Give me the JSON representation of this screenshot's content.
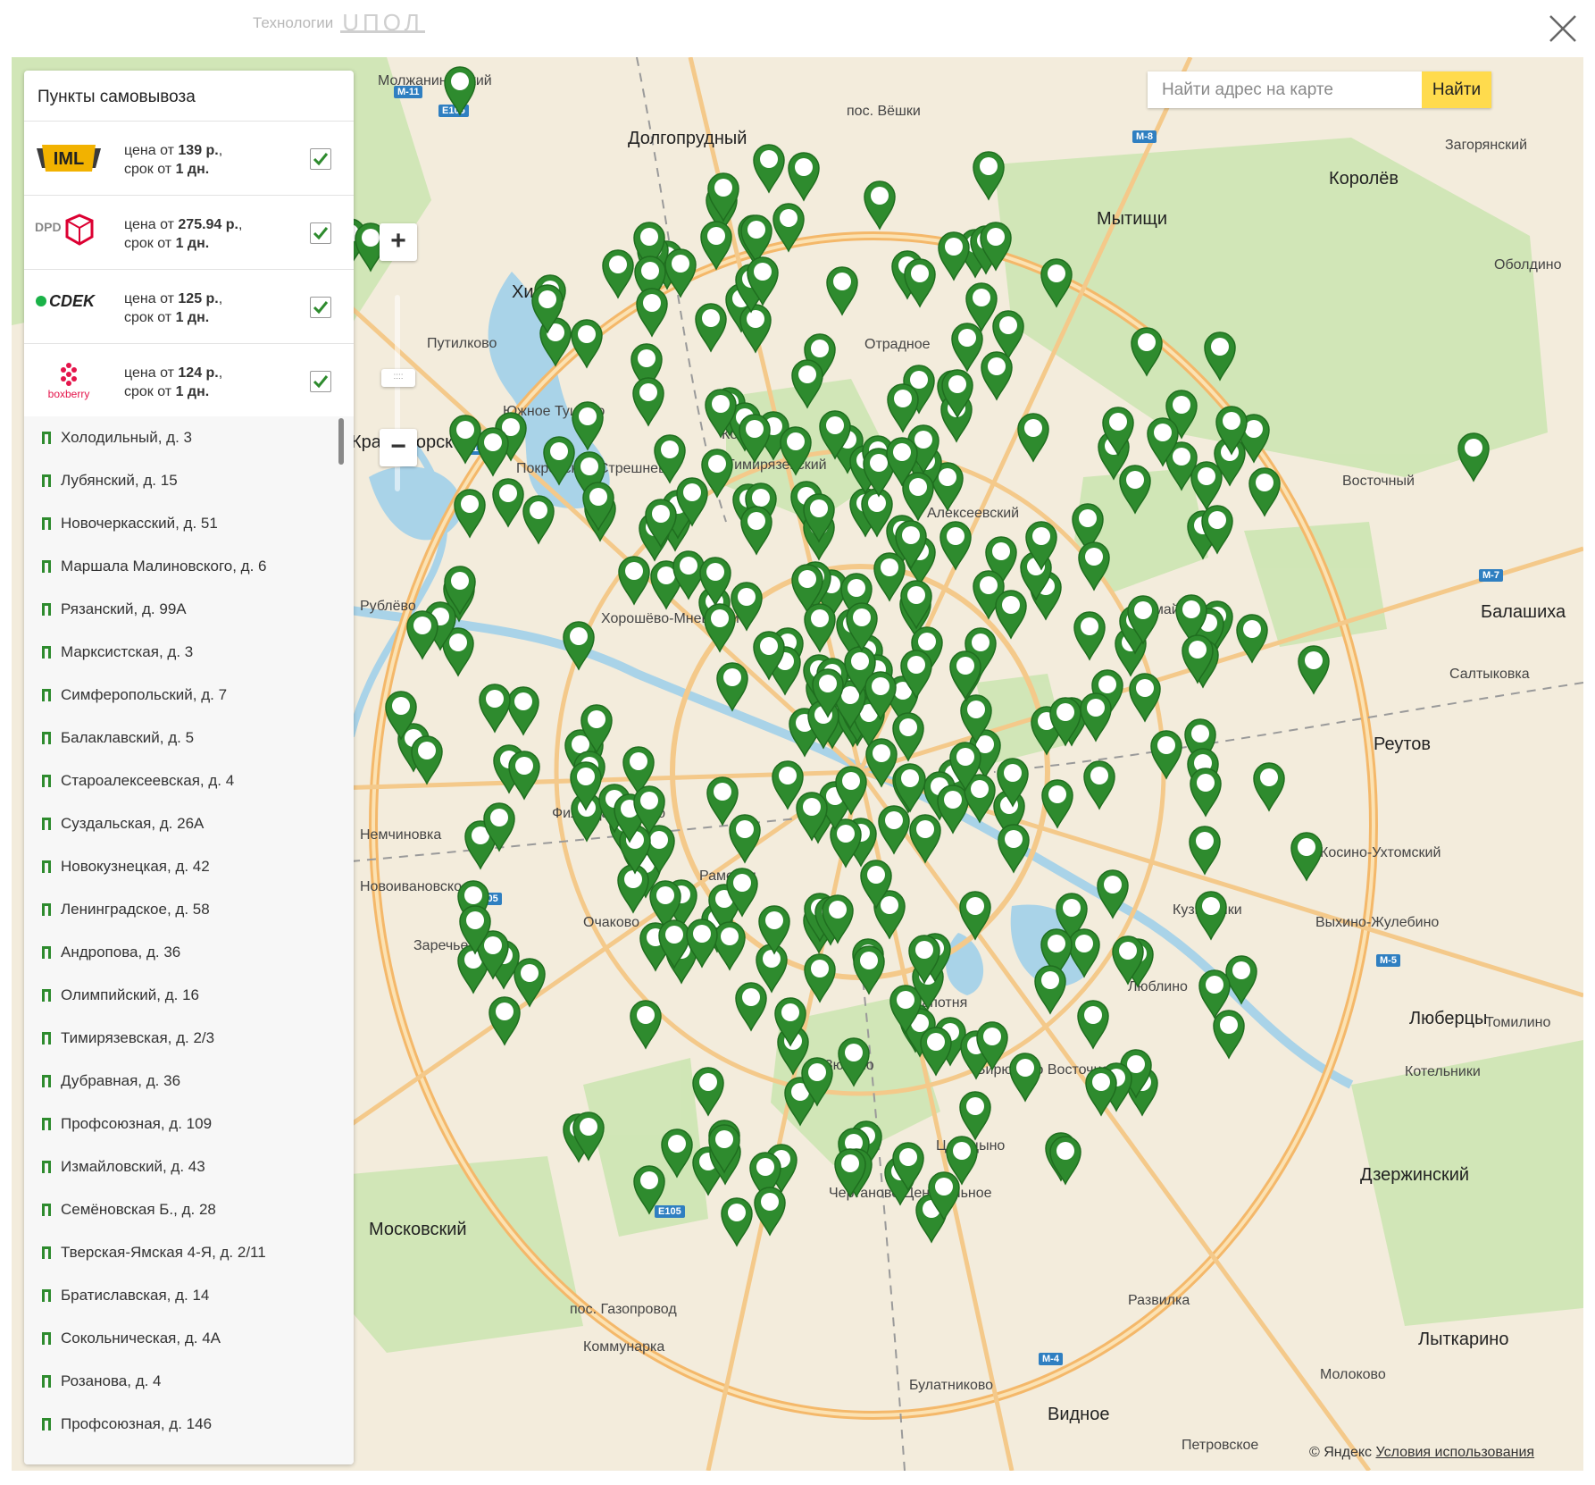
{
  "header": {
    "brand_text": "Технологии",
    "brand_logo": "UПОЛ",
    "close_icon": "close-icon"
  },
  "search": {
    "placeholder": "Найти адрес на карте",
    "button_label": "Найти"
  },
  "zoom": {
    "plus": "+",
    "minus": "−",
    "handle": "::::"
  },
  "panel": {
    "title": "Пункты самовывоза",
    "carriers": [
      {
        "name": "IML",
        "price_prefix": "цена от ",
        "price": "139 р.",
        "term_prefix": "срок от ",
        "term": "1 дн.",
        "checked": true
      },
      {
        "name": "DPD",
        "price_prefix": "цена от ",
        "price": "275.94 р.",
        "term_prefix": "срок от ",
        "term": "1 дн.",
        "checked": true
      },
      {
        "name": "CDEK",
        "price_prefix": "цена от ",
        "price": "125 р.",
        "term_prefix": "срок от ",
        "term": "1 дн.",
        "checked": true
      },
      {
        "name": "boxberry",
        "price_prefix": "цена от ",
        "price": "124 р.",
        "term_prefix": "срок от ",
        "term": "1 дн.",
        "checked": true
      }
    ],
    "points": [
      "Холодильный, д. 3",
      "Лубянский, д. 15",
      "Новочеркасский, д. 51",
      "Маршала Малиновского, д. 6",
      "Рязанский, д. 99А",
      "Марксистская, д. 3",
      "Симферопольский, д. 7",
      "Балаклавский, д. 5",
      "Староалексеевская, д. 4",
      "Суздальская, д. 26А",
      "Новокузнецкая, д. 42",
      "Ленинградское, д. 58",
      "Андропова, д. 36",
      "Олимпийский, д. 16",
      "Тимирязевская, д. 2/3",
      "Дубравная, д. 36",
      "Профсоюзная, д. 109",
      "Измайловский, д. 43",
      "Семёновская Б., д. 28",
      "Тверская-Ямская 4-Я, д. 2/11",
      "Братиславская, д. 14",
      "Сокольническая, д. 4А",
      "Розанова, д. 4",
      "Профсоюзная, д. 146"
    ]
  },
  "map": {
    "labels": [
      {
        "text": "Долгопрудный",
        "cls": "mid"
      },
      {
        "text": "Мытищи",
        "cls": "mid"
      },
      {
        "text": "Химки",
        "cls": "mid"
      },
      {
        "text": "Королёв",
        "cls": "mid"
      },
      {
        "text": "Балашиха",
        "cls": "mid"
      },
      {
        "text": "Реутов",
        "cls": "mid"
      },
      {
        "text": "Люберцы",
        "cls": "mid"
      },
      {
        "text": "Дзержинский",
        "cls": "mid"
      },
      {
        "text": "Лыткарино",
        "cls": "mid"
      },
      {
        "text": "Видное",
        "cls": "mid"
      },
      {
        "text": "Развилка",
        "cls": "small"
      },
      {
        "text": "Котельники",
        "cls": "small"
      },
      {
        "text": "Молжаниновский",
        "cls": "small"
      },
      {
        "text": "пос. Вёшки",
        "cls": "small"
      },
      {
        "text": "Загорянский",
        "cls": "small"
      },
      {
        "text": "Оболдино",
        "cls": "small"
      },
      {
        "text": "Восточный",
        "cls": "small"
      },
      {
        "text": "Салтыковка",
        "cls": "small"
      },
      {
        "text": "Измайлово",
        "cls": "small"
      },
      {
        "text": "Кузьминки",
        "cls": "small"
      },
      {
        "text": "Отрадное",
        "cls": "small"
      },
      {
        "text": "Путилково",
        "cls": "small"
      },
      {
        "text": "Южное Тушино",
        "cls": "small"
      },
      {
        "text": "Коптево",
        "cls": "small"
      },
      {
        "text": "Рублёво",
        "cls": "small"
      },
      {
        "text": "Немчиновка",
        "cls": "small"
      },
      {
        "text": "Новоивановское",
        "cls": "small"
      },
      {
        "text": "Заречье",
        "cls": "small"
      },
      {
        "text": "Фили-Давыдково",
        "cls": "small"
      },
      {
        "text": "Хорошёво-Мневники",
        "cls": "small"
      },
      {
        "text": "Раменки",
        "cls": "small"
      },
      {
        "text": "Очаково",
        "cls": "small"
      },
      {
        "text": "Зюзино",
        "cls": "small"
      },
      {
        "text": "Царицыно",
        "cls": "small"
      },
      {
        "text": "Чертаново Центральное",
        "cls": "small"
      },
      {
        "text": "Бирюлёво Восточное",
        "cls": "small"
      },
      {
        "text": "пос. Газопровод",
        "cls": "small"
      },
      {
        "text": "Коммунарка",
        "cls": "small"
      },
      {
        "text": "Булатниково",
        "cls": "small"
      },
      {
        "text": "Молоково",
        "cls": "small"
      },
      {
        "text": "Петровское",
        "cls": "small"
      },
      {
        "text": "Капотня",
        "cls": "small"
      },
      {
        "text": "Люблино",
        "cls": "small"
      },
      {
        "text": "Выхино-Жулебино",
        "cls": "small"
      },
      {
        "text": "Косино-Ухтомский",
        "cls": "small"
      },
      {
        "text": "Московский",
        "cls": "mid"
      },
      {
        "text": "Томилино",
        "cls": "small"
      },
      {
        "text": "Красногорск",
        "cls": "mid"
      },
      {
        "text": "Покровское-Стрешнево",
        "cls": "small"
      },
      {
        "text": "Алексеевский",
        "cls": "small"
      },
      {
        "text": "Тимирязевский",
        "cls": "small"
      }
    ],
    "roads": [
      "M-11",
      "E105",
      "M-8",
      "M-7",
      "M-5",
      "M-4",
      "E105",
      "E105",
      "E105"
    ]
  },
  "copyright": {
    "text": "© Яндекс ",
    "terms": "Условия использования"
  },
  "colors": {
    "pin": "#2e8b2e",
    "pin_dark": "#1f6e1f",
    "search_button": "#ffdb4d",
    "check": "#2e8b2e",
    "map_bg": "#f3ecdc",
    "park": "#cfe6b4",
    "water": "#a9d3e8",
    "ring": "#f4b86a"
  }
}
